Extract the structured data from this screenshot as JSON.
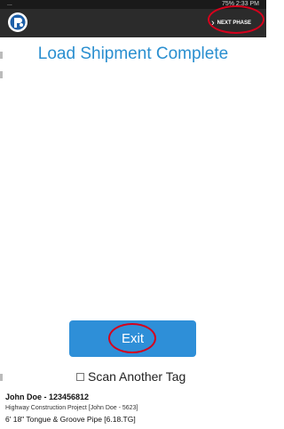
{
  "status_bar": {
    "left_text": "...",
    "right_text": "75% 2:33 PM"
  },
  "app_bar": {
    "logo_icon": "company-logo-icon",
    "next_phase_label": "NEXT PHASE",
    "next_phase_icon": "chevron-right-icon"
  },
  "page": {
    "title": "Load Shipment Complete"
  },
  "exit_button": {
    "label": "Exit"
  },
  "scan_another": {
    "label": "Scan Another Tag",
    "checked": false
  },
  "footer": {
    "user_line": "John Doe - 123456812",
    "project_line": "Highway Construction Project [John Doe - 5623]",
    "item_line": "6' 18\" Tongue & Groove Pipe [6.18.TG]"
  },
  "colors": {
    "title": "#2a8fd0",
    "button": "#2e8fd8",
    "appbar": "#2b2b2b",
    "annotation": "#d6001c"
  }
}
